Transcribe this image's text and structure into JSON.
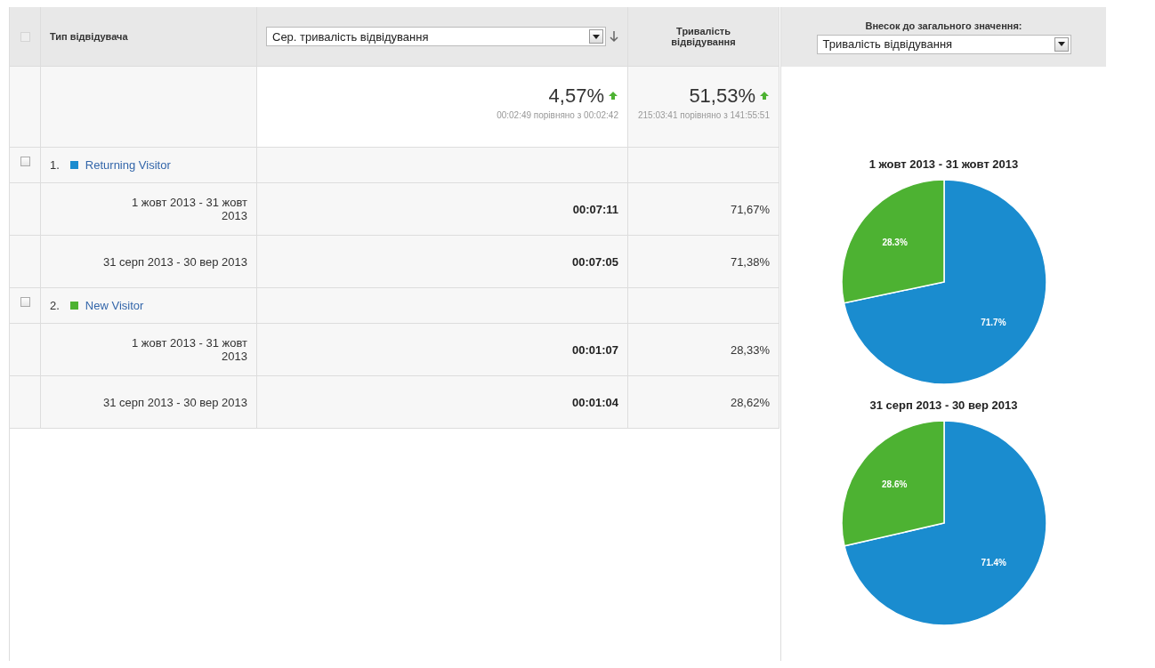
{
  "header": {
    "checkbox": {
      "disabled": true
    },
    "dimension": "Тип відвідувача",
    "metric_select": {
      "value": "Сер. тривалість відвідування"
    },
    "metric_column": "Тривалість відвідування",
    "contribution": {
      "label": "Внесок до загального значення:",
      "value": "Тривалість відвідування"
    }
  },
  "summary": [
    {
      "change": "4,57%",
      "comparison": "00:02:49 порівняно з 00:02:42"
    },
    {
      "change": "51,53%",
      "comparison": "215:03:41 порівняно з 141:55:51"
    }
  ],
  "groups": [
    {
      "index": "1.",
      "name": "Returning Visitor",
      "color": "#1a8ccf",
      "checked": false,
      "rows": [
        {
          "period": "1 жовт 2013 - 31 жовт 2013",
          "avg_duration": "00:07:11",
          "share": "71,67%"
        },
        {
          "period": "31 серп 2013 - 30 вер 2013",
          "avg_duration": "00:07:05",
          "share": "71,38%"
        }
      ]
    },
    {
      "index": "2.",
      "name": "New Visitor",
      "color": "#4db232",
      "checked": false,
      "rows": [
        {
          "period": "1 жовт 2013 - 31 жовт 2013",
          "avg_duration": "00:01:07",
          "share": "28,33%"
        },
        {
          "period": "31 серп 2013 - 30 вер 2013",
          "avg_duration": "00:01:04",
          "share": "28,62%"
        }
      ]
    }
  ],
  "charts": [
    {
      "chart_data": {
        "type": "pie",
        "title": "1 жовт 2013 - 31 жовт 2013",
        "values": [
          71.7,
          28.3
        ],
        "value_labels": [
          "71.7%",
          "28.3%"
        ]
      }
    },
    {
      "chart_data": {
        "type": "pie",
        "title": "31 серп 2013 - 30 вер 2013",
        "values": [
          71.4,
          28.6
        ],
        "value_labels": [
          "71.4%",
          "28.6%"
        ]
      }
    }
  ]
}
